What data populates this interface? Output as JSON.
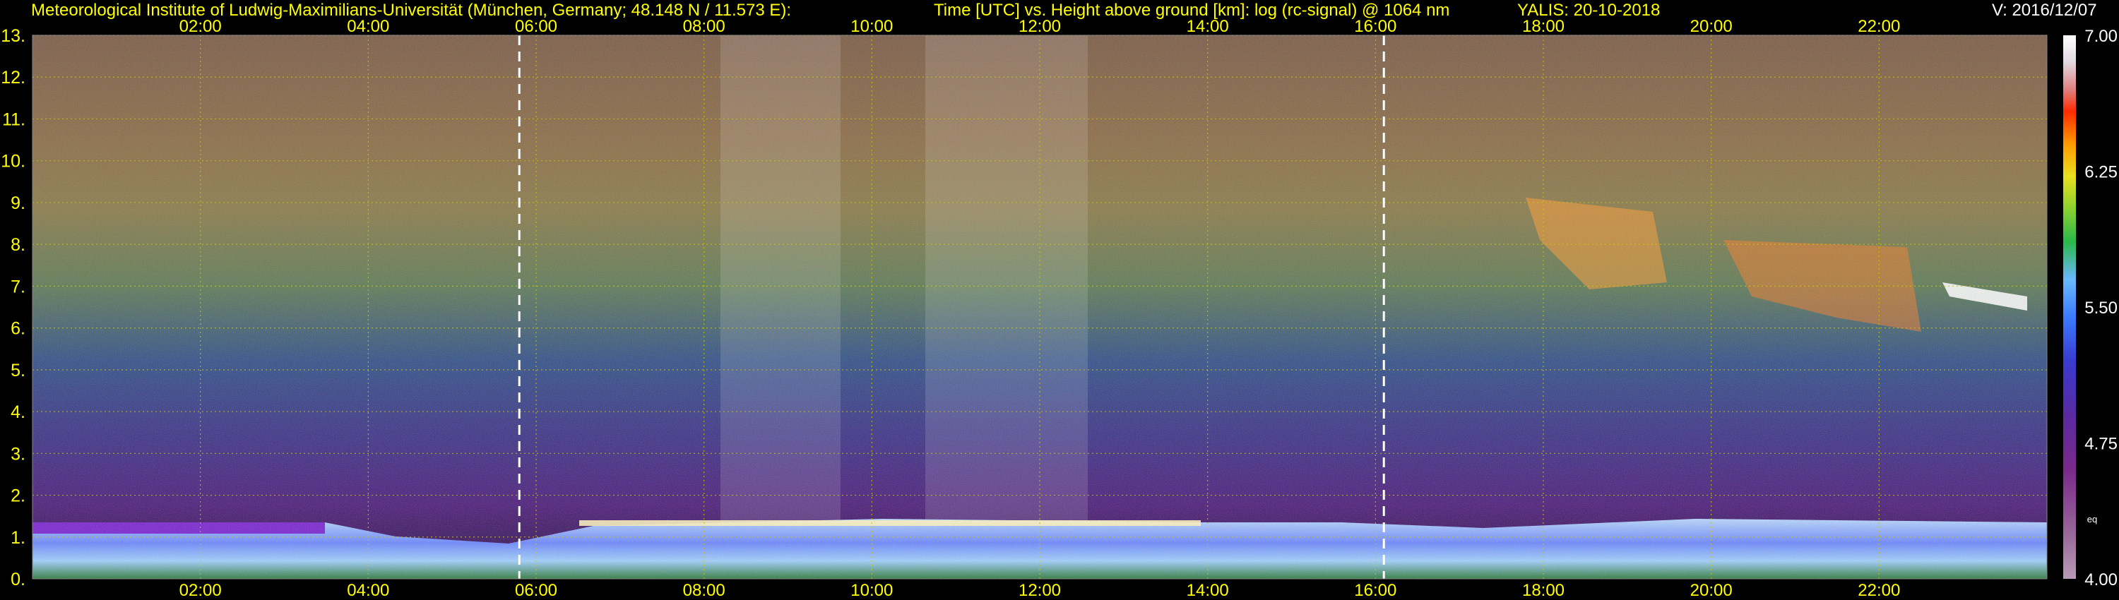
{
  "header": {
    "institute": "Meteorological Institute of Ludwig-Maximilians-Universität (München, Germany; 48.148 N / 11.573 E):",
    "plot_title": "Time [UTC] vs. Height above ground [km]: log (rc-signal) @ 1064 nm",
    "station_date": "YALIS: 20-10-2018",
    "version": "V: 2016/12/07"
  },
  "chart_data": {
    "type": "heatmap",
    "title": "Time [UTC] vs. Height above ground [km]: log (rc-signal) @ 1064 nm",
    "x": {
      "label": "Time [UTC]",
      "range": [
        "00:00",
        "24:00"
      ],
      "ticks": [
        "02:00",
        "04:00",
        "06:00",
        "08:00",
        "10:00",
        "12:00",
        "14:00",
        "16:00",
        "18:00",
        "20:00",
        "22:00"
      ],
      "tick_hours": [
        2,
        4,
        6,
        8,
        10,
        12,
        14,
        16,
        18,
        20,
        22
      ]
    },
    "y": {
      "label": "Height above ground [km]",
      "range": [
        0,
        13
      ],
      "ticks": [
        "0.",
        "1.",
        "2.",
        "3.",
        "4.",
        "5.",
        "6.",
        "7.",
        "8.",
        "9.",
        "10.",
        "11.",
        "12.",
        "13."
      ]
    },
    "colorbar": {
      "range": [
        4.0,
        7.0
      ],
      "ticks": [
        "7.00",
        "6.25",
        "5.50",
        "4.75",
        "4.00"
      ],
      "note": "eq"
    },
    "markers_hours": [
      5.8,
      16.1
    ],
    "grid": true,
    "colors": {
      "title_text": "#ffff00",
      "grid": "#c8c800",
      "background": "#000000",
      "marker": "#ffffff"
    }
  }
}
